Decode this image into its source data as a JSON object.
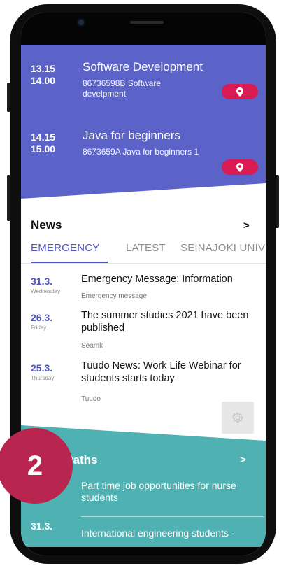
{
  "colors": {
    "schedule_bg": "#5b63c8",
    "accent": "#4b55c4",
    "pin": "#d81b52",
    "career_bg": "#4fb1b1",
    "badge": "#b8264f"
  },
  "schedule": {
    "events": [
      {
        "start": "13.15",
        "end": "14.00",
        "title": "Software Development",
        "subtitle": "86736598B Software develpment",
        "icon": "location-pin-icon"
      },
      {
        "start": "14.15",
        "end": "15.00",
        "title": "Java for beginners",
        "subtitle": "8673659A Java for beginners 1",
        "icon": "location-pin-icon"
      }
    ]
  },
  "news": {
    "title": "News",
    "more": ">",
    "tabs": [
      {
        "label": "EMERGENCY",
        "active": true
      },
      {
        "label": "LATEST"
      },
      {
        "label": "SEINÄJOKI UNIV"
      }
    ],
    "items": [
      {
        "date": "31.3.",
        "day": "Wednesday",
        "headline": "Emergency Message: Information",
        "source": "Emergency message"
      },
      {
        "date": "26.3.",
        "day": "Friday",
        "headline": "The summer studies 2021 have been published",
        "source": "Seamk"
      },
      {
        "date": "25.3.",
        "day": "Thursday",
        "headline": "Tuudo News: Work Life Webinar for students starts today",
        "source": "Tuudo"
      }
    ],
    "settings_icon": "gear-icon"
  },
  "career": {
    "title": "Career Paths",
    "title_visible": "er Paths",
    "more": ">",
    "items": [
      {
        "text": "Part time job opportunities for nurse students"
      },
      {
        "date": "31.3.",
        "text": "International engineering students -"
      }
    ]
  },
  "badge": {
    "number": "2"
  }
}
